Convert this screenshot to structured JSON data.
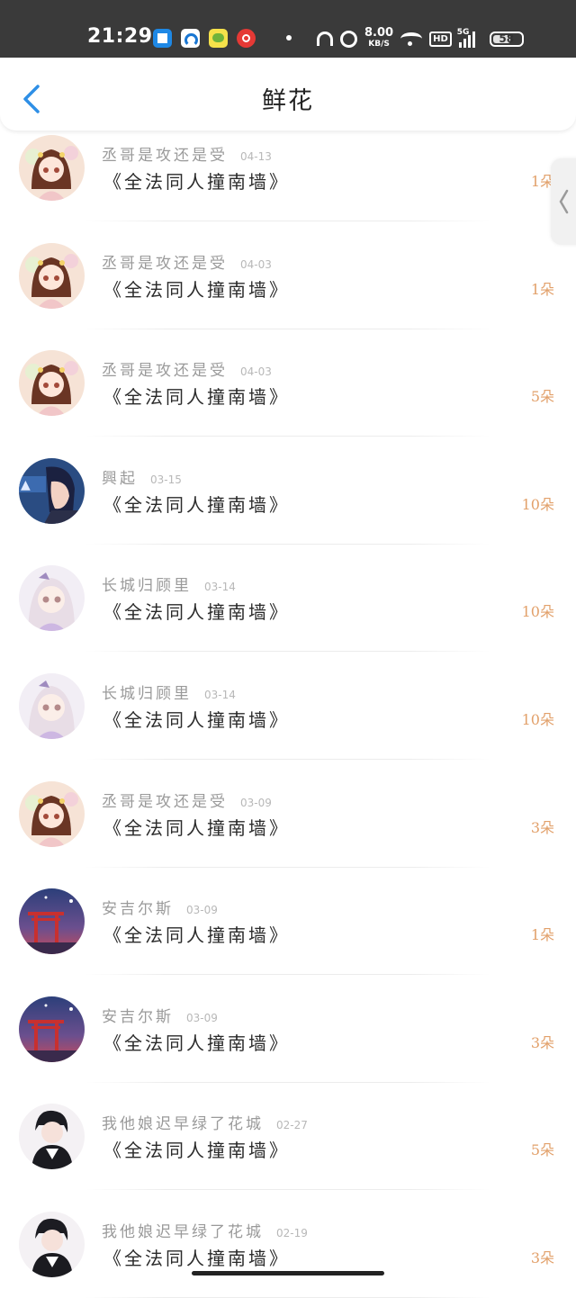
{
  "status_bar": {
    "time": "21:29",
    "net_speed": "8.00",
    "net_speed_unit": "KB/S",
    "hd": "HD",
    "network": "5G",
    "battery": "58"
  },
  "header": {
    "back_icon": "chevron-left-icon",
    "title": "鲜花"
  },
  "accent_color": "#e2a06a",
  "rows": [
    {
      "user": "丞哥是攻还是受",
      "date": "04-13",
      "work": "《全法同人撞南墙》",
      "count": "1朵",
      "avatar": "pink-girl"
    },
    {
      "user": "丞哥是攻还是受",
      "date": "04-03",
      "work": "《全法同人撞南墙》",
      "count": "1朵",
      "avatar": "pink-girl"
    },
    {
      "user": "丞哥是攻还是受",
      "date": "04-03",
      "work": "《全法同人撞南墙》",
      "count": "5朵",
      "avatar": "pink-girl"
    },
    {
      "user": "興起",
      "date": "03-15",
      "work": "《全法同人撞南墙》",
      "count": "10朵",
      "avatar": "blue-boy"
    },
    {
      "user": "长城归顾里",
      "date": "03-14",
      "work": "《全法同人撞南墙》",
      "count": "10朵",
      "avatar": "lilac-girl"
    },
    {
      "user": "长城归顾里",
      "date": "03-14",
      "work": "《全法同人撞南墙》",
      "count": "10朵",
      "avatar": "lilac-girl"
    },
    {
      "user": "丞哥是攻还是受",
      "date": "03-09",
      "work": "《全法同人撞南墙》",
      "count": "3朵",
      "avatar": "pink-girl"
    },
    {
      "user": "安吉尔斯",
      "date": "03-09",
      "work": "《全法同人撞南墙》",
      "count": "1朵",
      "avatar": "torii-night"
    },
    {
      "user": "安吉尔斯",
      "date": "03-09",
      "work": "《全法同人撞南墙》",
      "count": "3朵",
      "avatar": "torii-night"
    },
    {
      "user": "我他娘迟早绿了花城",
      "date": "02-27",
      "work": "《全法同人撞南墙》",
      "count": "5朵",
      "avatar": "dark-boy"
    },
    {
      "user": "我他娘迟早绿了花城",
      "date": "02-19",
      "work": "《全法同人撞南墙》",
      "count": "3朵",
      "avatar": "dark-boy"
    }
  ]
}
